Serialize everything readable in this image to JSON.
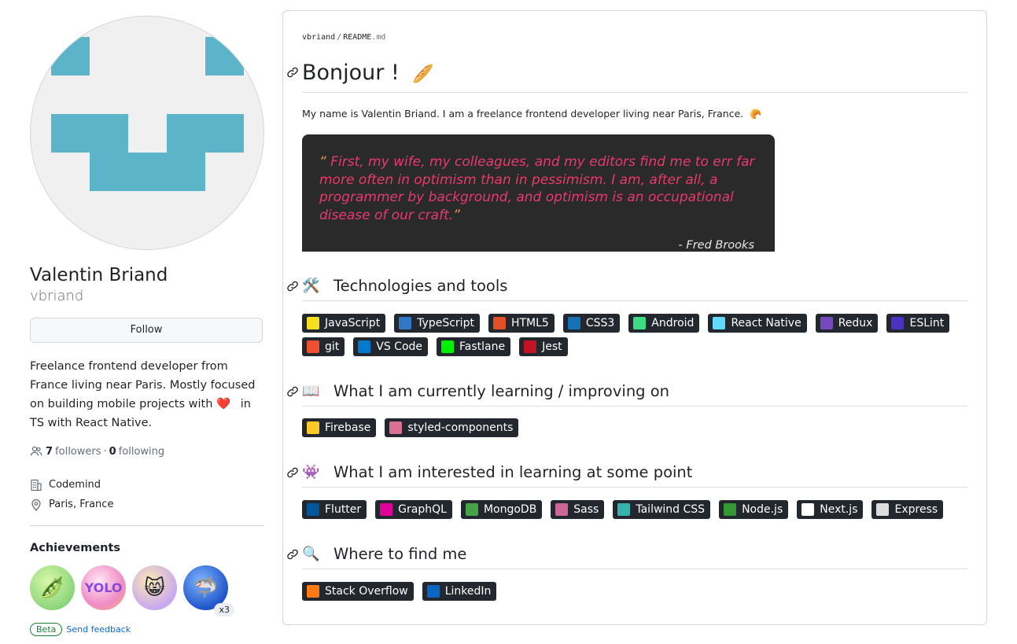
{
  "profile": {
    "full_name": "Valentin Briand",
    "login": "vbriand",
    "follow_label": "Follow",
    "bio_parts": [
      "Freelance frontend developer from France living near Paris. Mostly focused on building mobile projects with",
      "in TS with React Native."
    ],
    "followers_count": "7",
    "followers_label": "followers",
    "separator": "·",
    "following_count": "0",
    "following_label": "following",
    "company": "Codemind",
    "location": "Paris, France",
    "achievements_title": "Achievements",
    "achievement_multiplier": "x3",
    "beta_label": "Beta",
    "feedback_label": "Send feedback",
    "avatar_color": "#5bb4c8"
  },
  "readme": {
    "owner": "vbriand",
    "separator": "/",
    "file_base": "README",
    "file_ext": ".md",
    "title": "Bonjour !",
    "intro": "My name is Valentin Briand. I am a freelance frontend developer living near Paris, France.",
    "quote": {
      "text": "First, my wife, my colleagues, and my editors find me to err far more often in optimism than in pessimism. I am, after all, a programmer by background, and optimism is an occupational disease of our craft.",
      "open_mark": "“",
      "close_mark": "”",
      "author": "- Fred Brooks"
    },
    "sections": {
      "tech": "Technologies and tools",
      "learning": "What I am currently learning / improving on",
      "interested": "What I am interested in learning at some point",
      "find": "Where to find me"
    },
    "tech_badges": [
      {
        "label": "JavaScript",
        "icon": "js-icon",
        "icolor": "#f7df1e"
      },
      {
        "label": "TypeScript",
        "icon": "ts-icon",
        "icolor": "#3178c6"
      },
      {
        "label": "HTML5",
        "icon": "html5-icon",
        "icolor": "#e34f26"
      },
      {
        "label": "CSS3",
        "icon": "css3-icon",
        "icolor": "#1572b6"
      },
      {
        "label": "Android",
        "icon": "android-icon",
        "icolor": "#3ddc84"
      },
      {
        "label": "React Native",
        "icon": "react-icon",
        "icolor": "#61dafb"
      },
      {
        "label": "Redux",
        "icon": "redux-icon",
        "icolor": "#764abc"
      },
      {
        "label": "ESLint",
        "icon": "eslint-icon",
        "icolor": "#4b32c3"
      },
      {
        "label": "git",
        "icon": "git-icon",
        "icolor": "#f05032"
      },
      {
        "label": "VS Code",
        "icon": "vscode-icon",
        "icolor": "#007acc"
      },
      {
        "label": "Fastlane",
        "icon": "fastlane-icon",
        "icolor": "#00f200"
      },
      {
        "label": "Jest",
        "icon": "jest-icon",
        "icolor": "#c21325"
      }
    ],
    "learning_badges": [
      {
        "label": "Firebase",
        "icon": "firebase-icon",
        "icolor": "#ffca28"
      },
      {
        "label": "styled-components",
        "icon": "styled-components-icon",
        "icolor": "#db7093"
      }
    ],
    "interested_badges": [
      {
        "label": "Flutter",
        "icon": "flutter-icon",
        "icolor": "#02569b"
      },
      {
        "label": "GraphQL",
        "icon": "graphql-icon",
        "icolor": "#e10098"
      },
      {
        "label": "MongoDB",
        "icon": "mongodb-icon",
        "icolor": "#47a248"
      },
      {
        "label": "Sass",
        "icon": "sass-icon",
        "icolor": "#cc6699"
      },
      {
        "label": "Tailwind CSS",
        "icon": "tailwind-icon",
        "icolor": "#38b2ac"
      },
      {
        "label": "Node.js",
        "icon": "nodejs-icon",
        "icolor": "#339933"
      },
      {
        "label": "Next.js",
        "icon": "nextjs-icon",
        "icolor": "#ffffff"
      },
      {
        "label": "Express",
        "icon": "express-icon",
        "icolor": "#dddddd"
      }
    ],
    "find_badges": [
      {
        "label": "Stack Overflow",
        "icon": "stackoverflow-icon",
        "icolor": "#fe7a16"
      },
      {
        "label": "LinkedIn",
        "icon": "linkedin-icon",
        "icolor": "#0a66c2"
      }
    ]
  }
}
